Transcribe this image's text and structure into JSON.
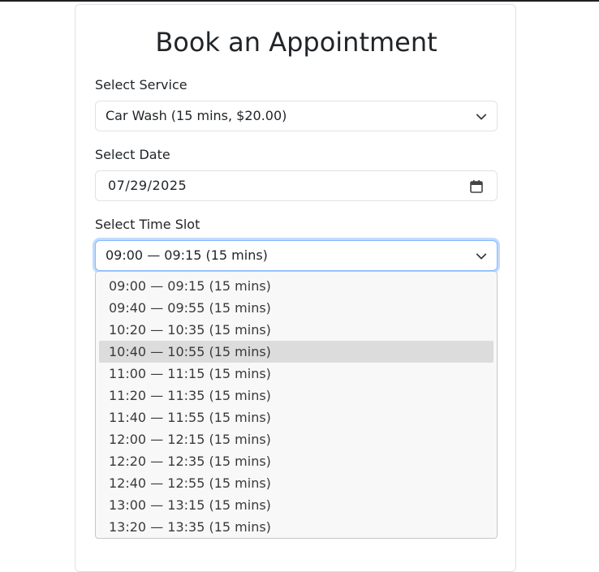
{
  "page": {
    "title": "Book an Appointment"
  },
  "service": {
    "label": "Select Service",
    "value": "Car Wash (15 mins, $20.00)"
  },
  "date": {
    "label": "Select Date",
    "value": "07/29/2025"
  },
  "timeslot": {
    "label": "Select Time Slot",
    "value": "09:00 — 09:15 (15 mins)",
    "highlighted_index": 3,
    "options": [
      "09:00 — 09:15 (15 mins)",
      "09:40 — 09:55 (15 mins)",
      "10:20 — 10:35 (15 mins)",
      "10:40 — 10:55 (15 mins)",
      "11:00 — 11:15 (15 mins)",
      "11:20 — 11:35 (15 mins)",
      "11:40 — 11:55 (15 mins)",
      "12:00 — 12:15 (15 mins)",
      "12:20 — 12:35 (15 mins)",
      "12:40 — 12:55 (15 mins)",
      "13:00 — 13:15 (15 mins)",
      "13:20 — 13:35 (15 mins)"
    ]
  },
  "icons": {
    "select_chevron": "chevron-down-icon",
    "date_picker": "calendar-icon"
  },
  "colors": {
    "focus_border": "#86b7fe",
    "highlight": "#dcdcdc",
    "dropdown_bg": "#f8f8f8"
  }
}
